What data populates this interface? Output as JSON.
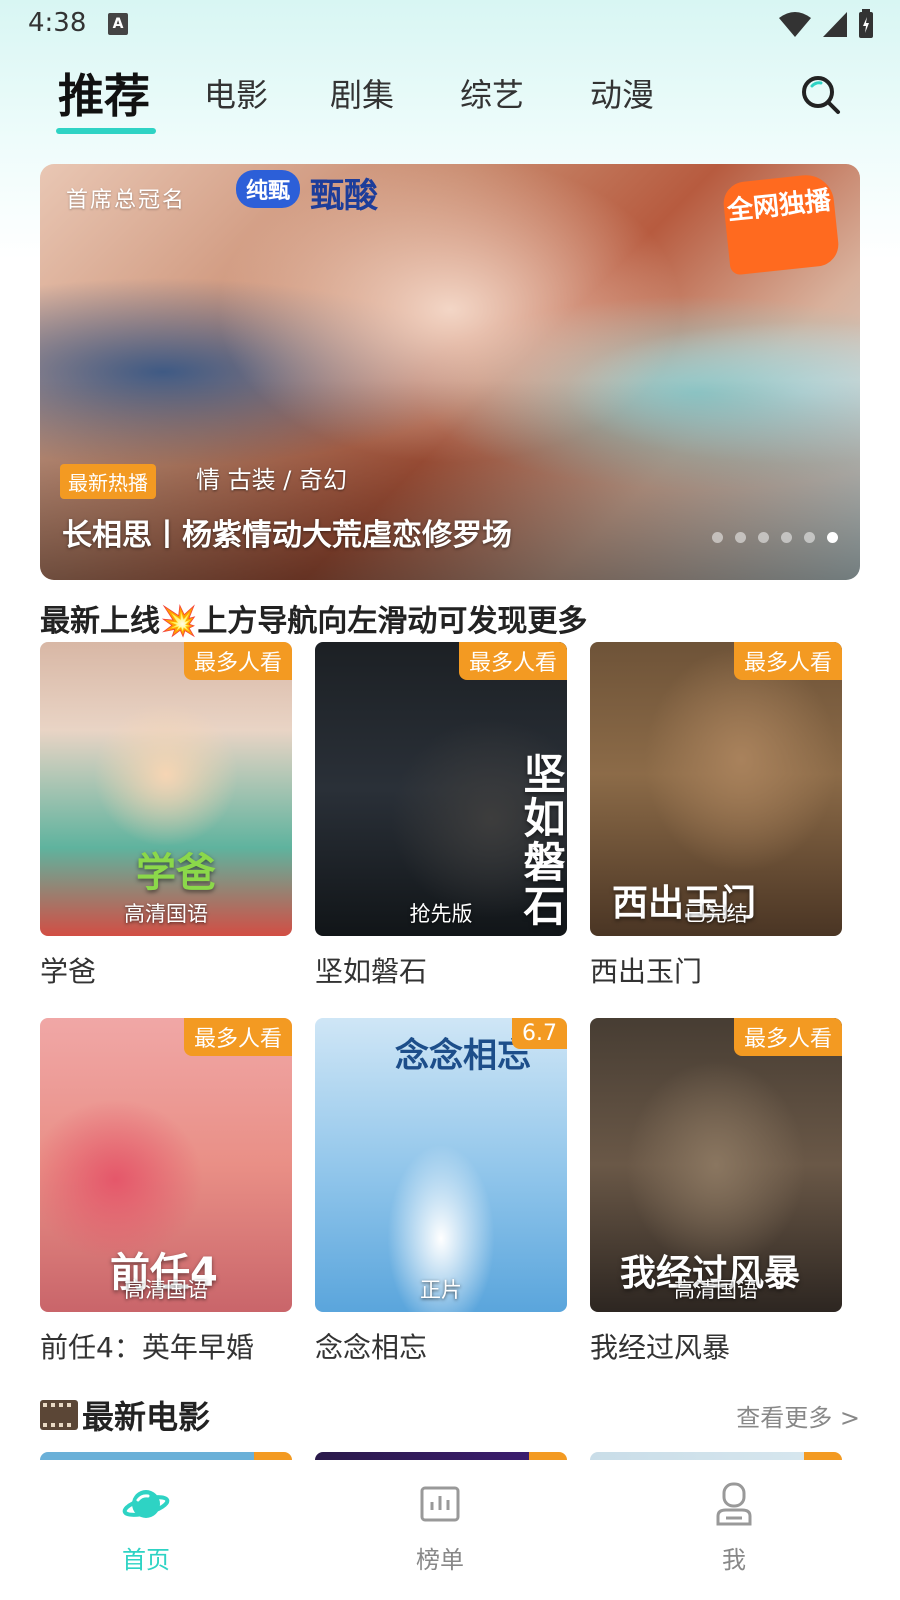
{
  "status_bar": {
    "time": "4:38",
    "notif_letter": "A"
  },
  "tabs": [
    {
      "label": "推荐",
      "active": true
    },
    {
      "label": "电影"
    },
    {
      "label": "剧集"
    },
    {
      "label": "综艺"
    },
    {
      "label": "动漫"
    }
  ],
  "banner": {
    "sponsor_text": "首席总冠名",
    "sponsor_logo_1": "纯甄",
    "sponsor_logo_2": "甄酸",
    "exclusive_badge": "全网独播",
    "tag": "最新热播",
    "genre": "情 古装 / 奇幻",
    "title": "长相思丨杨紫情动大荒虐恋修罗场",
    "slide_count": 6,
    "active_slide": 6
  },
  "section_new": {
    "title": "最新上线💥上方导航向左滑动可发现更多",
    "items": [
      {
        "title": "学爸",
        "badge": "最多人看",
        "caption": "高清国语",
        "poster_text": "学爸"
      },
      {
        "title": "坚如磐石",
        "badge": "最多人看",
        "caption": "抢先版",
        "poster_text": "坚如磐石"
      },
      {
        "title": "西出玉门",
        "badge": "最多人看",
        "caption": "已完结",
        "poster_text": "西出玉门"
      },
      {
        "title": "前任4：英年早婚",
        "badge": "最多人看",
        "caption": "高清国语",
        "poster_text": "前任4"
      },
      {
        "title": "念念相忘",
        "badge": "6.7",
        "caption": "正片",
        "poster_text": "念念相忘"
      },
      {
        "title": "我经过风暴",
        "badge": "最多人看",
        "caption": "高清国语",
        "poster_text": "我经过风暴"
      }
    ]
  },
  "section_movies": {
    "title": "最新电影",
    "see_more": "查看更多 >"
  },
  "bottom_nav": [
    {
      "label": "首页",
      "icon": "planet-icon",
      "active": true
    },
    {
      "label": "榜单",
      "icon": "chart-icon"
    },
    {
      "label": "我",
      "icon": "user-icon"
    }
  ],
  "colors": {
    "accent": "#2ed3c4",
    "badge": "#f39a22"
  }
}
